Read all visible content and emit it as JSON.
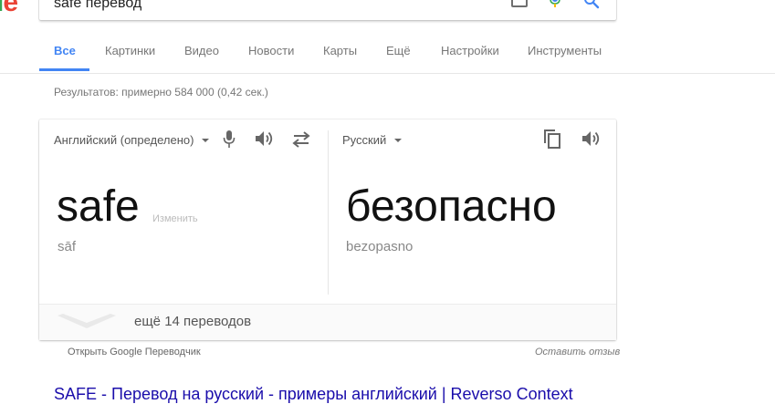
{
  "search": {
    "query": "safe перевод"
  },
  "tabs": [
    {
      "label": "Все",
      "active": true
    },
    {
      "label": "Картинки"
    },
    {
      "label": "Видео"
    },
    {
      "label": "Новости"
    },
    {
      "label": "Карты"
    },
    {
      "label": "Ещё"
    },
    {
      "label": "Настройки"
    },
    {
      "label": "Инструменты"
    }
  ],
  "results_count": "Результатов: примерно 584 000 (0,42 сек.)",
  "translator": {
    "source_lang": "Английский (определено)",
    "target_lang": "Русский",
    "source_word": "safe",
    "change_label": "Изменить",
    "source_translit": "sāf",
    "target_word": "безопасно",
    "target_translit": "bezopasno",
    "more_translations": "ещё 14 переводов"
  },
  "footer": {
    "open_translate": "Открыть Google Переводчик",
    "feedback": "Оставить отзыв"
  },
  "first_result": {
    "title": "SAFE - Перевод на русский - примеры английский | Reverso Context"
  },
  "icons": {
    "mic": "microphone-icon",
    "speaker": "speaker-icon",
    "swap": "swap-languages-icon",
    "copy": "copy-icon",
    "search": "search-icon",
    "keyboard": "keyboard-icon",
    "chevron": "chevron-down-icon"
  },
  "colors": {
    "accent": "#4285f4",
    "link": "#1a0dab"
  }
}
